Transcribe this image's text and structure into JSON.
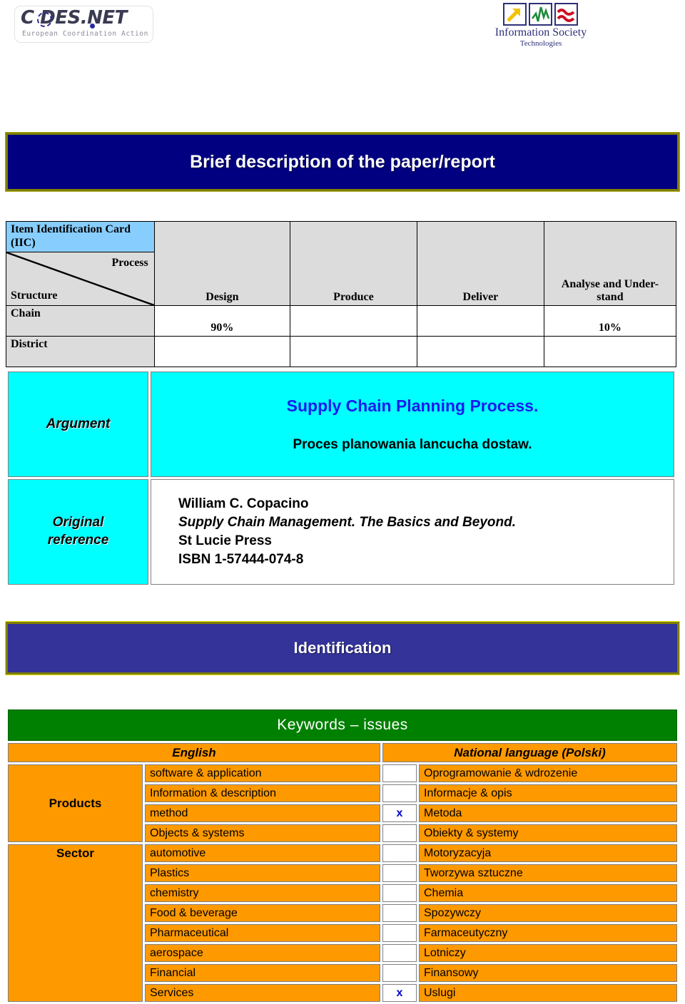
{
  "logos": {
    "codesnet": {
      "wordmark": "C   DES.NET",
      "tagline": "European Coordination Action",
      "ring_icon": "codesnet-ring-icon",
      "dot_icon": "codesnet-dot-icon"
    },
    "ist": {
      "name": "Information Society",
      "subtitle": "Technologies",
      "squares": [
        {
          "icon": "arrow-up-right-icon",
          "color": "#f2c200"
        },
        {
          "icon": "zigzag-line-icon",
          "color": "#1f8a3b"
        },
        {
          "icon": "double-wave-icon",
          "color": "#cc1122"
        }
      ]
    }
  },
  "banners": {
    "brief": "Brief description of the paper/report",
    "identification": "Identification",
    "brief_bg": "#000080",
    "identification_bg": "#333399",
    "border": "#7f7f00"
  },
  "iic": {
    "card_title_line1": "Item Identification Card",
    "card_title_line2": "(IIC)",
    "card_bg": "#87ceff",
    "axis_process": "Process",
    "axis_structure": "Structure",
    "process_columns": [
      "Design",
      "Produce",
      "Deliver",
      "Analyse and Under-stand"
    ],
    "rows": [
      {
        "label": "Chain",
        "cells": [
          "90%",
          "",
          "",
          "10%"
        ]
      },
      {
        "label": "District",
        "cells": [
          "",
          "",
          "",
          ""
        ]
      }
    ]
  },
  "argument": {
    "label": "Argument",
    "english": "Supply Chain Planning Process.",
    "national": "Proces planowania lancucha dostaw.",
    "bg": "#00ffff",
    "english_color": "#1a1aee"
  },
  "reference": {
    "label_line1": "Original",
    "label_line2": "reference",
    "author": "William C. Copacino",
    "title": "Supply Chain Management. The Basics and Beyond.",
    "publisher": "St Lucie Press",
    "isbn": "ISBN 1-57444-074-8"
  },
  "keywords": {
    "banner": "Keywords – issues",
    "banner_bg": "#008000",
    "row_bg": "#ff9900",
    "check_color": "#0000cc",
    "col_english": "English",
    "col_national": "National  language (Polski)",
    "group_products": "Products",
    "group_sector": "Sector",
    "rows": [
      {
        "english": "software & application",
        "check": "",
        "national": "Oprogramowanie & wdrozenie"
      },
      {
        "english": "Information & description",
        "check": "",
        "national": "Informacje & opis"
      },
      {
        "english": "method",
        "check": "x",
        "national": "Metoda"
      },
      {
        "english": "Objects & systems",
        "check": "",
        "national": "Obiekty & systemy"
      },
      {
        "english": "automotive",
        "check": "",
        "national": "Motoryzacyja"
      },
      {
        "english": "Plastics",
        "check": "",
        "national": "Tworzywa sztuczne"
      },
      {
        "english": "chemistry",
        "check": "",
        "national": "Chemia"
      },
      {
        "english": "Food & beverage",
        "check": "",
        "national": "Spozywczy"
      },
      {
        "english": "Pharmaceutical",
        "check": "",
        "national": "Farmaceutyczny"
      },
      {
        "english": "aerospace",
        "check": "",
        "national": "Lotniczy"
      },
      {
        "english": "Financial",
        "check": "",
        "national": "Finansowy"
      },
      {
        "english": "Services",
        "check": "x",
        "national": "Uslugi"
      }
    ]
  }
}
